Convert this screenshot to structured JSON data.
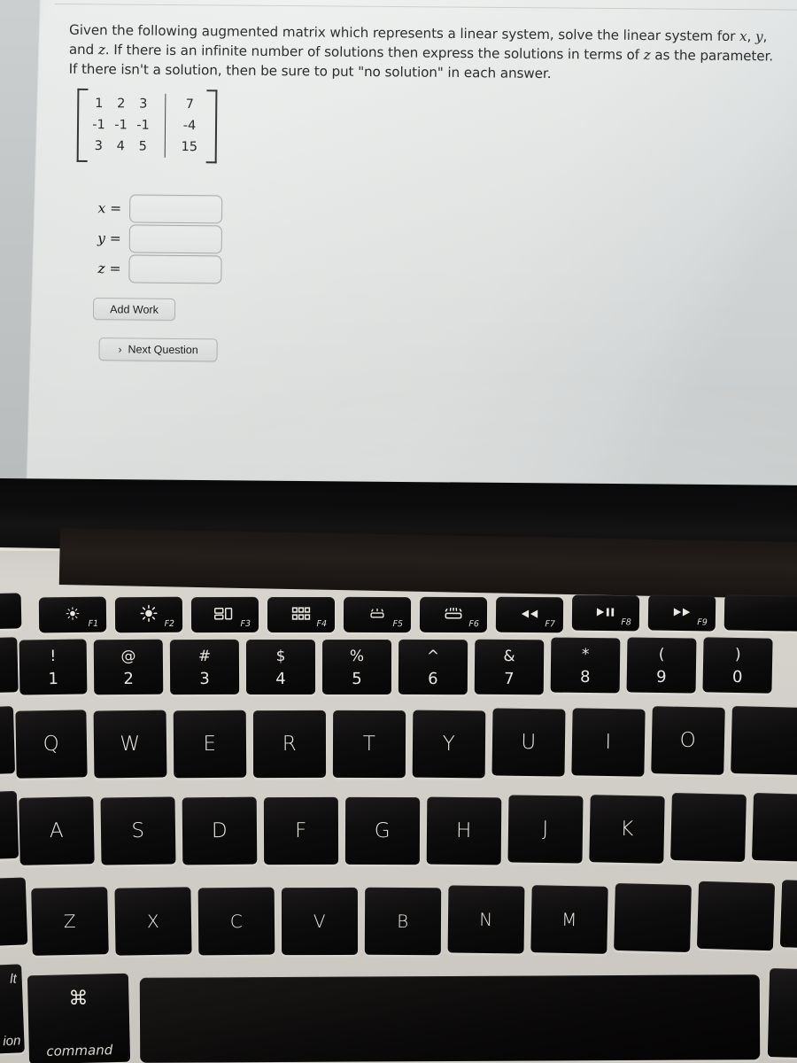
{
  "screen": {
    "question": {
      "line1_a": "Given the following augmented matrix which represents a linear system, solve the linear system for ",
      "var_x": "x",
      "sep1": ", ",
      "var_y": "y",
      "line1_b": ", and ",
      "var_z2": "z",
      "line2_a": ". If there is an infinite number of solutions then express the solutions in terms of ",
      "var_z3": "z",
      "line2_b": " as the parameter. If there isn't a solution, then be sure to put \"no solution\" in each answer."
    },
    "matrix": {
      "coefficients": [
        [
          "1",
          "2",
          "3"
        ],
        [
          "-1",
          "-1",
          "-1"
        ],
        [
          "3",
          "4",
          "5"
        ]
      ],
      "constants": [
        "7",
        "-4",
        "15"
      ]
    },
    "answers": [
      {
        "label": "x =",
        "value": "",
        "placeholder": ""
      },
      {
        "label": "y =",
        "value": "",
        "placeholder": ""
      },
      {
        "label": "z =",
        "value": "",
        "placeholder": ""
      }
    ],
    "buttons": {
      "add_work": "Add Work",
      "next_question": "Next Question",
      "next_chevron": "›"
    },
    "colors": {
      "screen_bg": "#eceeed",
      "text": "#18191a",
      "button_bg": "#e8eae9",
      "input_border": "#a9adad"
    }
  },
  "keyboard": {
    "function_row": [
      {
        "key": "esc",
        "label": "",
        "fnum": "",
        "icon": "esc-partial"
      },
      {
        "key": "f1",
        "fnum": "F1",
        "icon": "brightness-down-icon"
      },
      {
        "key": "f2",
        "fnum": "F2",
        "icon": "brightness-up-icon"
      },
      {
        "key": "f3",
        "fnum": "F3",
        "icon": "mission-control-icon"
      },
      {
        "key": "f4",
        "fnum": "F4",
        "icon": "launchpad-icon"
      },
      {
        "key": "f5",
        "fnum": "F5",
        "icon": "keyboard-backlight-down-icon"
      },
      {
        "key": "f6",
        "fnum": "F6",
        "icon": "keyboard-backlight-up-icon"
      },
      {
        "key": "f7",
        "fnum": "F7",
        "icon": "rewind-icon"
      },
      {
        "key": "f8",
        "fnum": "F8",
        "icon": "play-pause-icon"
      },
      {
        "key": "f9",
        "fnum": "F9",
        "icon": "fast-forward-icon"
      },
      {
        "key": "f10",
        "fnum": "",
        "icon": ""
      }
    ],
    "number_row": [
      {
        "sym": "",
        "num": ""
      },
      {
        "sym": "!",
        "num": "1"
      },
      {
        "sym": "@",
        "num": "2"
      },
      {
        "sym": "#",
        "num": "3"
      },
      {
        "sym": "$",
        "num": "4"
      },
      {
        "sym": "%",
        "num": "5"
      },
      {
        "sym": "^",
        "num": "6"
      },
      {
        "sym": "&",
        "num": "7"
      },
      {
        "sym": "*",
        "num": "8"
      },
      {
        "sym": "(",
        "num": "9"
      },
      {
        "sym": ")",
        "num": "0"
      }
    ],
    "qwerty_row": [
      "Q",
      "W",
      "E",
      "R",
      "T",
      "Y",
      "U",
      "I",
      "O"
    ],
    "asdf_row": [
      "A",
      "S",
      "D",
      "F",
      "G",
      "H",
      "J",
      "K"
    ],
    "zxcv_row": [
      "Z",
      "X",
      "C",
      "V",
      "B",
      "N",
      "M"
    ],
    "bottom_row": {
      "option_top": "lt",
      "option_bottom": "ion",
      "command_glyph": "⌘",
      "command_label": "command",
      "space_label": ""
    }
  }
}
